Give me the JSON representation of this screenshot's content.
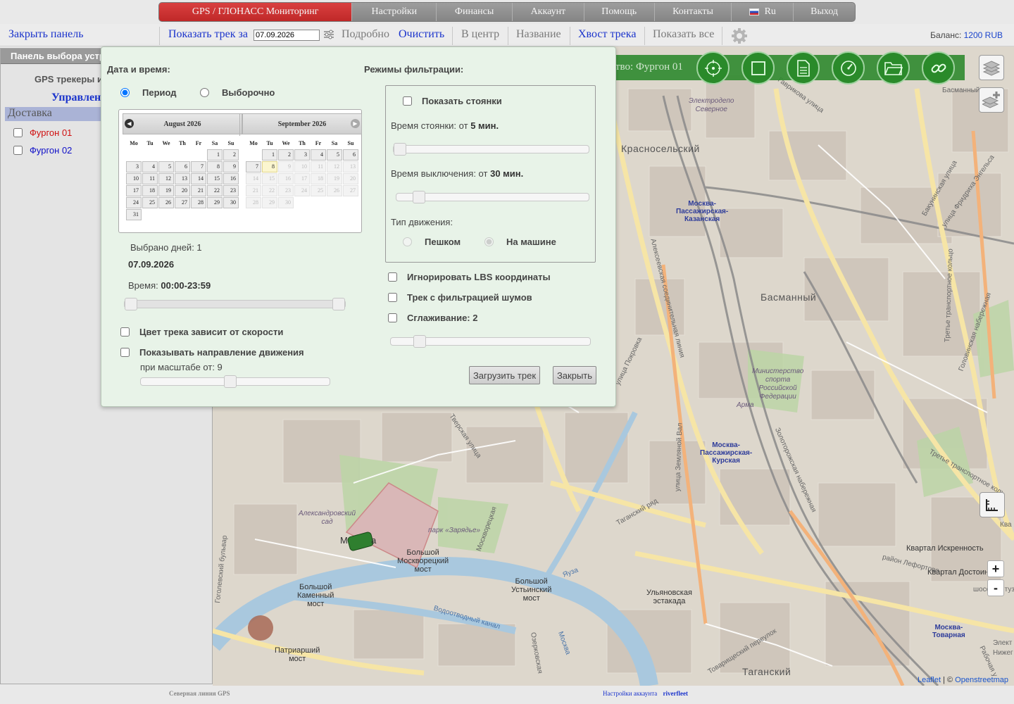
{
  "topmenu": {
    "brand": "GPS / ГЛОНАСС Мониторинг",
    "items": [
      "Настройки",
      "Финансы",
      "Аккаунт",
      "Помощь",
      "Контакты",
      "Ru",
      "Выход"
    ]
  },
  "toolbar": {
    "close_panel": "Закрыть панель",
    "show_track": "Показать трек за",
    "date": "07.09.2026",
    "details": "Подробно",
    "clear": "Очистить",
    "center": "В центр",
    "name": "Название",
    "tail": "Хвост трека",
    "show_all": "Показать все",
    "balance_label": "Баланс:",
    "balance_value": "1200 RUB"
  },
  "left_panel": {
    "header": "Панель выбора устр",
    "trackers": "GPS трекеры и",
    "manage": "Управлен",
    "group": "Доставка",
    "devices": [
      {
        "name": "Фургон 01",
        "color": "#d01010"
      },
      {
        "name": "Фургон 02",
        "color": "#1010c8"
      }
    ]
  },
  "tools": {
    "vehicle_title": "тво: Фургон 01",
    "icons": [
      "target-icon",
      "square-icon",
      "document-icon",
      "speedometer-icon",
      "folder-icon",
      "link-icon"
    ]
  },
  "map": {
    "labels": {
      "krasnoselsky": "Красносельский",
      "basmanny": "Басманный",
      "tagansky": "Таганский",
      "kazanskaya": "Москва-\nПассажирская-\nКазанская",
      "kurskaya": "Москва-\nПассажирская-\nКурская",
      "tovarnaya": "Москва-\nТоварная",
      "ministry": "Министерство\nспорта\nРоссийской\nФедерации",
      "arma": "Арма",
      "elektrodepo": "Электродепо\nСеверное",
      "bolshoy_moskvoretsky": "Большой\nМоскворецкий\nмост",
      "bolshoy_kamenny": "Большой\nКаменный\nмост",
      "bolshoy_ustinsky": "Большой\nУстьинский\nмост",
      "ulyanovskaya": "Ульяновская\nэстакада",
      "patriarshy": "Патриарший\nмост",
      "alexandrovsky": "Александровский\nсад",
      "zaryadye": "парк «Зарядье»",
      "kvartal": "Квартал Искренность",
      "kvartal_dost": "Квартал Достоин",
      "basmanny_ra": "Басманный ра",
      "moskva_m": "М",
      "moskva_a": "а",
      "pokrovka": "улица Покровка",
      "zemlyanoy": "улица Земляной Вал",
      "yauza": "Яуза",
      "moskva_river": "Москва",
      "vodootvodny": "Водоотводный канал",
      "tverskaya": "Тверская улица",
      "gavrikova": "Гаврикова улица",
      "bakuninskaya": "Бакунинская улица",
      "engelsa": "улица Фридриха Энгельса",
      "golovinskaya": "Головинская набережная",
      "ttk": "Третье транспортное кольцо",
      "ttk2": "Третье транспортное коль",
      "tovarishchesky": "Товарищеский переулок",
      "rabochaya": "Рабочая у",
      "shosse": "шоссе Энтузиа",
      "nizheg": "Нижег",
      "elekt": "Элект",
      "kva": "Ква",
      "lefortovo": "район Лефортово",
      "tagansky_ryad": "Таганский ряд",
      "alekseevsky": "Алексеевская соединительная линия",
      "zolotorozhskaya": "Золоторожская набережная",
      "gogolevsky": "Гоголевский бульвар",
      "moskvoretskaya": "Москворецкая",
      "ozerkovskaya": "Озерковская"
    },
    "attribution_leaflet": "Leaflet",
    "attribution_sep": "| ©",
    "attribution_osm": "Openstreetmap"
  },
  "dialog": {
    "datetime_title": "Дата и время:",
    "period": "Период",
    "selective": "Выборочно",
    "calendar": {
      "months": [
        {
          "title": "August 2026",
          "days": [
            [
              "",
              "",
              "",
              "",
              "",
              "1",
              "2"
            ],
            [
              "3",
              "4",
              "5",
              "6",
              "7",
              "8",
              "9"
            ],
            [
              "10",
              "11",
              "12",
              "13",
              "14",
              "15",
              "16"
            ],
            [
              "17",
              "18",
              "19",
              "20",
              "21",
              "22",
              "23"
            ],
            [
              "24",
              "25",
              "26",
              "27",
              "28",
              "29",
              "30"
            ],
            [
              "31",
              "",
              "",
              "",
              "",
              "",
              ""
            ]
          ]
        },
        {
          "title": "September 2026",
          "days": [
            [
              "",
              "1",
              "2",
              "3",
              "4",
              "5",
              "6"
            ],
            [
              "7",
              "8",
              "9",
              "10",
              "11",
              "12",
              "13"
            ],
            [
              "14",
              "15",
              "16",
              "17",
              "18",
              "19",
              "20"
            ],
            [
              "21",
              "22",
              "23",
              "24",
              "25",
              "26",
              "27"
            ],
            [
              "28",
              "29",
              "30",
              "",
              "",
              "",
              ""
            ]
          ],
          "today": "8",
          "disabled_from": 9
        }
      ],
      "weekdays": [
        "Mo",
        "Tu",
        "We",
        "Th",
        "Fr",
        "Sa",
        "Su"
      ]
    },
    "selected_days": "Выбрано дней: 1",
    "selected_date": "07.09.2026",
    "time_label": "Время:",
    "time_value": "00:00-23:59",
    "color_by_speed": "Цвет трека зависит от скорости",
    "show_direction": "Показывать направление движения",
    "scale_from": "при масштабе от: 9",
    "filter_title": "Режимы фильтрации:",
    "show_stops": "Показать стоянки",
    "stop_time_label": "Время стоянки: от",
    "stop_time_value": "5 мин.",
    "off_time_label": "Время выключения: от",
    "off_time_value": "30 мин.",
    "movement_type": "Тип движения:",
    "walk": "Пешком",
    "car": "На машине",
    "ignore_lbs": "Игнорировать LBS координаты",
    "noise_filter": "Трек с фильтрацией шумов",
    "smoothing": "Сглаживание: 2",
    "load_track": "Загрузить трек",
    "close": "Закрыть",
    "time_range_fraction": [
      0.0,
      1.0
    ],
    "stop_slider_fraction": 0.0,
    "off_slider_fraction": 0.09,
    "smoothing_fraction": 0.12,
    "scale_fraction": 0.47
  },
  "footer": {
    "left": "Северная линия GPS",
    "settings": "Настройки аккаунта",
    "user": "riverfleet"
  }
}
